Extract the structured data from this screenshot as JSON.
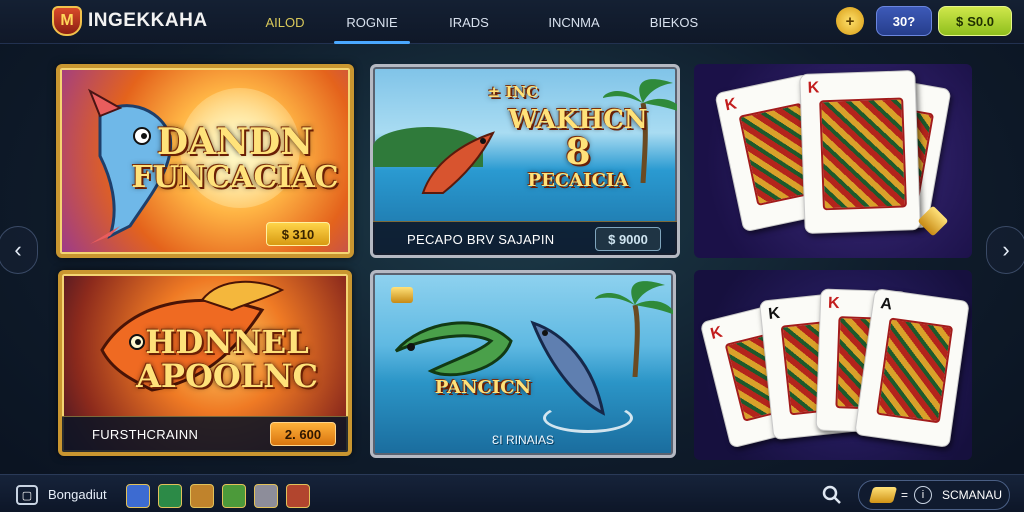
{
  "header": {
    "brand": "INGEKKAHA",
    "brand_logo_letter": "M",
    "tabs": [
      {
        "label": "AILOD",
        "active": false
      },
      {
        "label": "ROGNIE",
        "active": true
      },
      {
        "label": "IRADS",
        "active": false
      },
      {
        "label": "INCNMA",
        "active": false
      },
      {
        "label": "BIEKOS",
        "active": false
      }
    ],
    "coin_symbol": "+",
    "blue_pill": "30?",
    "green_pill_icon": "$",
    "green_pill": "S0.0"
  },
  "games": [
    {
      "title_line1": "DANDN",
      "title_line2": "FUNCACIAC",
      "price": "$ 310",
      "price_icon": "coin-icon"
    },
    {
      "title_top": "± INC",
      "title_line1": "WAKHCN",
      "title_number": "8",
      "title_line2": "PECAICIA",
      "footer": "PECAPO BRV SAJAPIN",
      "price": "$ 9000"
    },
    {
      "kind": "playing-cards",
      "ranks": [
        "K",
        "K",
        "K"
      ]
    },
    {
      "title_line1": "HDNNEL",
      "title_line2": "APOOLNC",
      "footer": "FURSTHCRAINN",
      "price": "2. 600"
    },
    {
      "title_line1": "PANCICN",
      "footer": "ƐI RINAIAS"
    },
    {
      "kind": "playing-cards",
      "ranks": [
        "K",
        "K",
        "K",
        "A"
      ]
    }
  ],
  "nav_arrows": {
    "left": "‹",
    "right": "›"
  },
  "footer": {
    "label": "Bongadiut",
    "avatars": [
      "#3d6bd1",
      "#2c8a47",
      "#c0832c",
      "#4c9a3a",
      "#8d8d9a",
      "#b2452e"
    ],
    "wallet_text": "SCMANAU",
    "info_glyph": "i",
    "eq_sign": "="
  },
  "colors": {
    "accent_tab": "#4aa8ff",
    "gold": "#c99630",
    "green_pill": "#a6d228"
  }
}
